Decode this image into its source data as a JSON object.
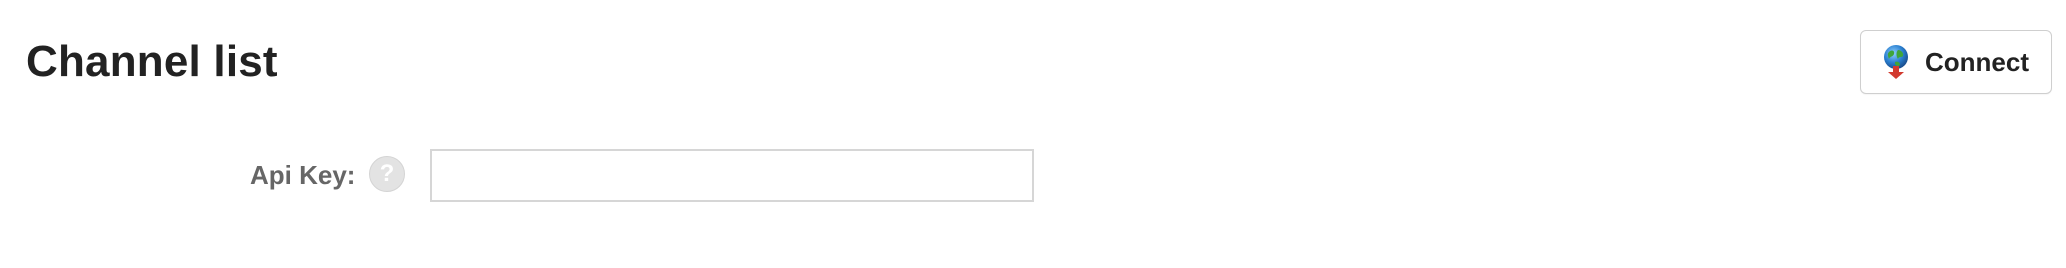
{
  "header": {
    "title": "Channel list"
  },
  "toolbar": {
    "connect_label": "Connect",
    "connect_icon": "globe-connect-icon"
  },
  "form": {
    "api_key": {
      "label": "Api Key:",
      "value": "",
      "placeholder": "",
      "help_glyph": "?",
      "help_icon": "help-icon"
    }
  },
  "colors": {
    "title": "#222222",
    "label": "#666666",
    "input_border": "#d6d6d6",
    "button_border": "#cfcfcf",
    "help_bg": "#e3e3e3"
  }
}
